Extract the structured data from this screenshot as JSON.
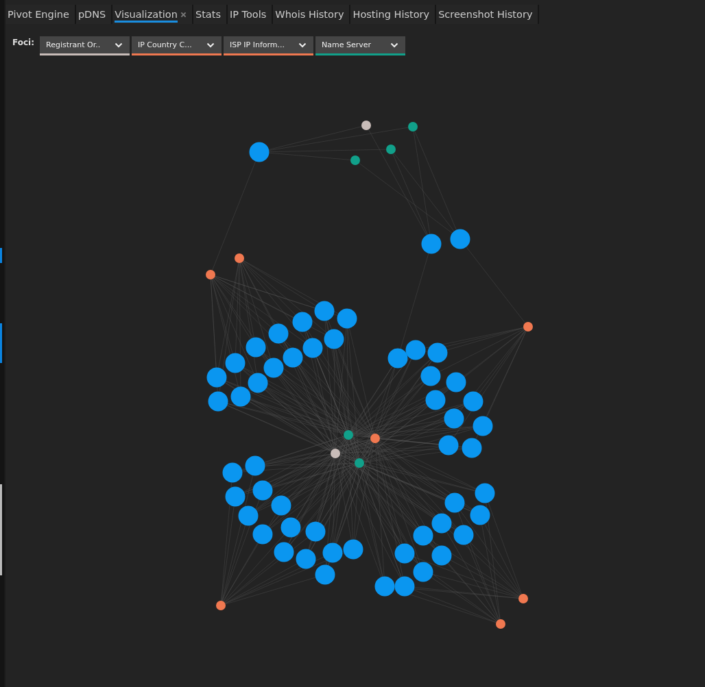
{
  "tabs": [
    {
      "label": "Pivot Engine",
      "selected": false,
      "closable": false
    },
    {
      "label": "pDNS",
      "selected": false,
      "closable": false
    },
    {
      "label": "Visualization",
      "selected": true,
      "closable": true
    },
    {
      "label": "Stats",
      "selected": false,
      "closable": false
    },
    {
      "label": "IP Tools",
      "selected": false,
      "closable": false
    },
    {
      "label": "Whois History",
      "selected": false,
      "closable": false
    },
    {
      "label": "Hosting History",
      "selected": false,
      "closable": false
    },
    {
      "label": "Screenshot History",
      "selected": false,
      "closable": false
    }
  ],
  "foci": {
    "label": "Foci:",
    "dropdowns": [
      {
        "label": "Registrant Or..",
        "color": "#c8bcb8"
      },
      {
        "label": "IP Country C...",
        "color": "#f07850"
      },
      {
        "label": "ISP IP Inform...",
        "color": "#f07850"
      },
      {
        "label": "Name Server",
        "color": "#11a08a"
      }
    ]
  }
}
